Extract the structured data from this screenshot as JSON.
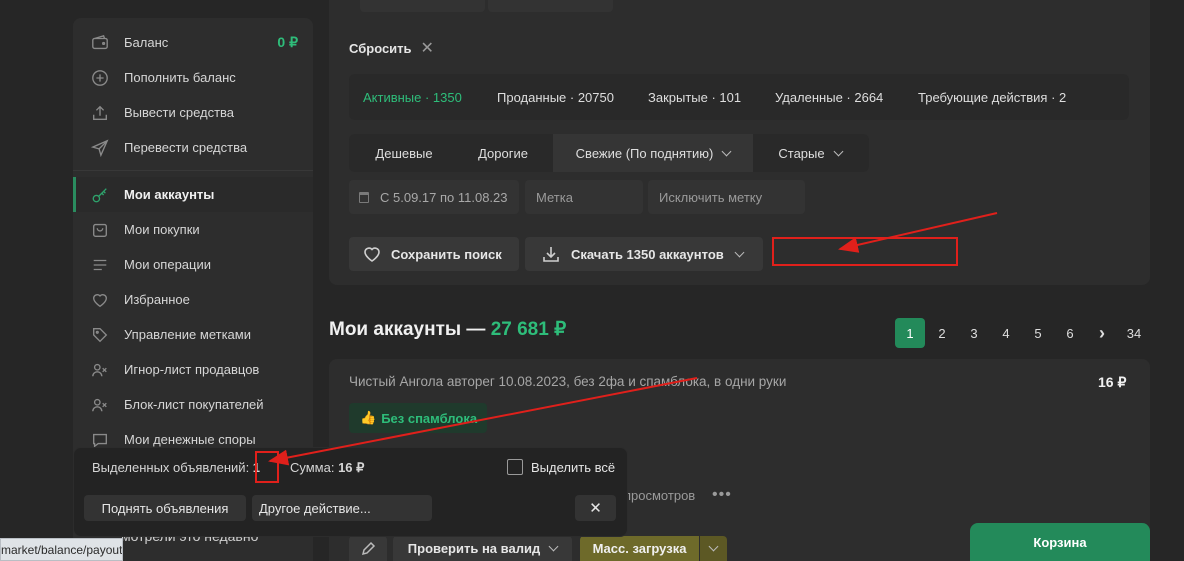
{
  "sidebar": {
    "balance_label": "Баланс",
    "balance_value": "0 ₽",
    "items": [
      {
        "label": "Пополнить баланс",
        "icon": "plus-circle-icon"
      },
      {
        "label": "Вывести средства",
        "icon": "upload-icon"
      },
      {
        "label": "Перевести средства",
        "icon": "send-icon"
      },
      {
        "label": "Мои аккаунты",
        "icon": "key-icon",
        "active": true
      },
      {
        "label": "Мои покупки",
        "icon": "bag-icon"
      },
      {
        "label": "Мои операции",
        "icon": "list-icon"
      },
      {
        "label": "Избранное",
        "icon": "heart-icon"
      },
      {
        "label": "Управление метками",
        "icon": "tag-icon"
      },
      {
        "label": "Игнор-лист продавцов",
        "icon": "user-x-icon"
      },
      {
        "label": "Блок-лист покупателей",
        "icon": "user-x-icon"
      },
      {
        "label": "Мои денежные споры",
        "icon": "chat-icon"
      }
    ],
    "partial_bottom": "мотрели это недавно"
  },
  "filters": {
    "reset_label": "Сбросить",
    "tabs": [
      {
        "label": "Активные · 1350",
        "active": true
      },
      {
        "label": "Проданные · 20750"
      },
      {
        "label": "Закрытые · 101"
      },
      {
        "label": "Удаленные · 2664"
      },
      {
        "label": "Требующие действия · 2"
      }
    ],
    "sort": [
      "Дешевые",
      "Дорогие",
      "Свежие (По поднятию)",
      "Старые"
    ],
    "date_range": "С 5.09.17 по 11.08.23",
    "tag_placeholder": "Метка",
    "exclude_tag_placeholder": "Исключить метку",
    "save_search": "Сохранить поиск",
    "download": "Скачать 1350 аккаунтов"
  },
  "heading": {
    "title": "Мои аккаунты — ",
    "sum": "27 681 ₽"
  },
  "pagination": [
    "1",
    "2",
    "3",
    "4",
    "5",
    "6",
    "34"
  ],
  "listing": {
    "title": "Чистый Ангола авторег 10.08.2023, без 2фа и спамблока, в одни руки",
    "price": "16 ₽",
    "badge": "Без спамблока",
    "views_partial": "просмотров",
    "btn_check": "Проверить на валид",
    "btn_mass": "Масс. загрузка"
  },
  "selection": {
    "selected_label": "Выделенных объявлений: ",
    "selected_count": "1",
    "sum_label": "Сумма: ",
    "sum_value": "16 ₽",
    "select_all": "Выделить всё",
    "raise": "Поднять объявления",
    "other": "Другое действие..."
  },
  "url_tooltip": "market/balance/payout",
  "cart": "Корзина",
  "colors": {
    "accent": "#2ebd7a",
    "annotation": "#e0201b"
  }
}
